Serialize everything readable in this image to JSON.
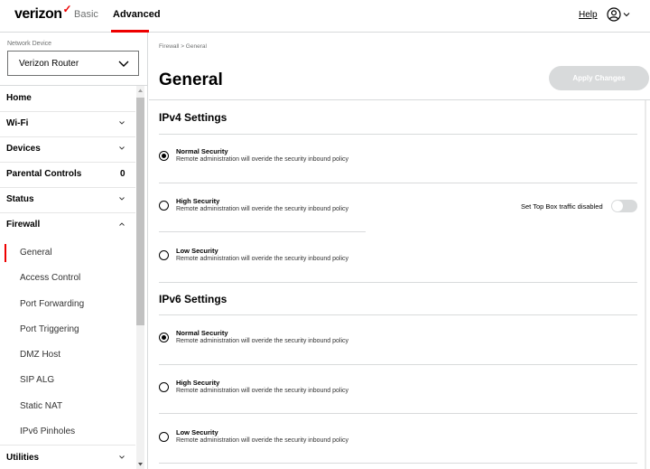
{
  "header": {
    "logo": "verizon",
    "tabs": [
      {
        "label": "Basic"
      },
      {
        "label": "Advanced"
      }
    ],
    "help_label": "Help",
    "accent_color": "#ee0000"
  },
  "sidebar": {
    "network_device_label": "Network Device",
    "device_selected": "Verizon Router",
    "items": [
      {
        "label": "Home"
      },
      {
        "label": "Wi-Fi"
      },
      {
        "label": "Devices"
      },
      {
        "label": "Parental Controls",
        "count": "0"
      },
      {
        "label": "Status"
      },
      {
        "label": "Firewall"
      },
      {
        "label": "Utilities"
      }
    ],
    "firewall_sub": [
      {
        "label": "General",
        "active": true
      },
      {
        "label": "Access Control"
      },
      {
        "label": "Port Forwarding"
      },
      {
        "label": "Port Triggering"
      },
      {
        "label": "DMZ Host"
      },
      {
        "label": "SIP ALG"
      },
      {
        "label": "Static NAT"
      },
      {
        "label": "IPv6 Pinholes"
      }
    ]
  },
  "main": {
    "breadcrumb": "Firewall  >  General",
    "title": "General",
    "apply_label": "Apply Changes",
    "ipv4": {
      "title": "IPv4 Settings",
      "options": [
        {
          "title": "Normal Security",
          "desc": "Remote administration will overide the security inbound policy",
          "checked": true
        },
        {
          "title": "High Security",
          "desc": "Remote administration will overide the security inbound policy",
          "checked": false
        },
        {
          "title": "Low Security",
          "desc": "Remote administration will overide the security inbound policy",
          "checked": false
        }
      ],
      "stb_label": "Set Top Box traffic disabled",
      "stb_enabled": false
    },
    "ipv6": {
      "title": "IPv6 Settings",
      "options": [
        {
          "title": "Normal Security",
          "desc": "Remote administration will overide the security inbound policy",
          "checked": true
        },
        {
          "title": "High Security",
          "desc": "Remote administration will overide the security inbound policy",
          "checked": false
        },
        {
          "title": "Low Security",
          "desc": "Remote administration will overide the security inbound policy",
          "checked": false
        }
      ]
    }
  }
}
